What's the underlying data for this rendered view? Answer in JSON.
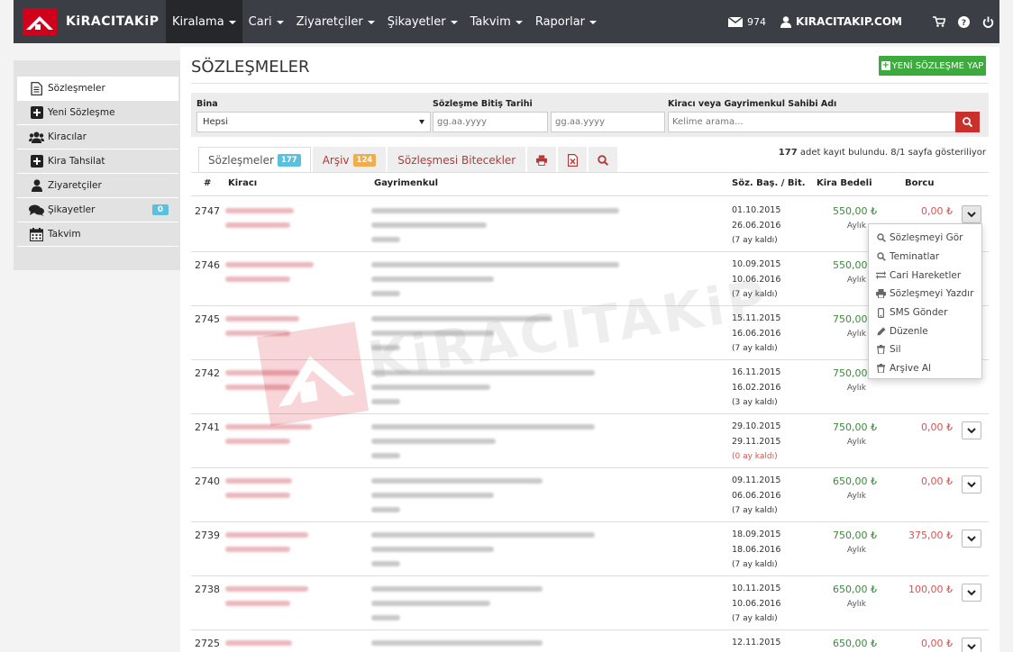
{
  "app": {
    "brand": "KiRACITAKiP",
    "nav": [
      "Kiralama",
      "Cari",
      "Ziyaretçiler",
      "Şikayetler",
      "Takvim",
      "Raporlar"
    ],
    "mail_count": "974",
    "site": "KIRACITAKIP.COM"
  },
  "sidebar": {
    "items": [
      {
        "label": "Sözleşmeler",
        "icon": "document-icon"
      },
      {
        "label": "Yeni Sözleşme",
        "icon": "plus-box-icon"
      },
      {
        "label": "Kiracılar",
        "icon": "users-icon"
      },
      {
        "label": "Kira Tahsilat",
        "icon": "plus-box-icon"
      },
      {
        "label": "Ziyaretçiler",
        "icon": "user-icon"
      },
      {
        "label": "Şikayetler",
        "icon": "comments-icon",
        "badge": "0"
      },
      {
        "label": "Takvim",
        "icon": "calendar-icon"
      }
    ]
  },
  "page": {
    "title": "SÖZLEŞMELER",
    "new_button": "YENİ SÖZLEŞME YAP"
  },
  "filters": {
    "bina_label": "Bina",
    "bina_value": "Hepsi",
    "date_label": "Sözleşme Bitiş Tarihi",
    "date_from_placeholder": "gg.aa.yyyy",
    "date_to_placeholder": "gg.aa.yyyy",
    "search_label": "Kiracı veya Gayrimenkul Sahibi Adı",
    "search_placeholder": "Kelime arama..."
  },
  "tabs": {
    "contracts": "Sözleşmeler",
    "contracts_count": "177",
    "archive": "Arşiv",
    "archive_count": "124",
    "ending": "Sözleşmesi Bitecekler"
  },
  "record_info": {
    "count": "177",
    "text": "adet kayıt bulundu. 8/1 sayfa gösteriliyor"
  },
  "table": {
    "headers": {
      "no": "#",
      "tenant": "Kiracı",
      "property": "Gayrimenkul",
      "dates": "Söz. Baş. / Bit.",
      "rent": "Kira Bedeli",
      "debt": "Borcu"
    },
    "rows": [
      {
        "no": "2747",
        "start": "01.10.2015",
        "end": "26.06.2016",
        "remaining": "(7 ay kaldı)",
        "rent": "550,00 ₺",
        "period": "Aylık",
        "debt": "0,00 ₺"
      },
      {
        "no": "2746",
        "start": "10.09.2015",
        "end": "10.06.2016",
        "remaining": "(7 ay kaldı)",
        "rent": "550,00 ₺",
        "period": "Aylık",
        "debt": ""
      },
      {
        "no": "2745",
        "start": "15.11.2015",
        "end": "16.06.2016",
        "remaining": "(7 ay kaldı)",
        "rent": "750,00 ₺",
        "period": "Aylık",
        "debt": ""
      },
      {
        "no": "2742",
        "start": "16.11.2015",
        "end": "16.02.2016",
        "remaining": "(3 ay kaldı)",
        "rent": "750,00 ₺",
        "period": "Aylık",
        "debt": ""
      },
      {
        "no": "2741",
        "start": "29.10.2015",
        "end": "29.11.2015",
        "remaining": "(0 ay kaldı)",
        "rent": "750,00 ₺",
        "period": "Aylık",
        "debt": "0,00 ₺"
      },
      {
        "no": "2740",
        "start": "09.11.2015",
        "end": "06.06.2016",
        "remaining": "(7 ay kaldı)",
        "rent": "650,00 ₺",
        "period": "Aylık",
        "debt": "0,00 ₺"
      },
      {
        "no": "2739",
        "start": "18.09.2015",
        "end": "18.06.2016",
        "remaining": "(7 ay kaldı)",
        "rent": "750,00 ₺",
        "period": "Aylık",
        "debt": "375,00 ₺"
      },
      {
        "no": "2738",
        "start": "10.11.2015",
        "end": "10.06.2016",
        "remaining": "(7 ay kaldı)",
        "rent": "650,00 ₺",
        "period": "Aylık",
        "debt": "100,00 ₺"
      },
      {
        "no": "2725",
        "start": "12.11.2015",
        "end": "",
        "remaining": "",
        "rent": "650,00 ₺",
        "period": "",
        "debt": "0,00 ₺"
      }
    ]
  },
  "dropdown": {
    "items": [
      {
        "label": "Sözleşmeyi Gör",
        "icon": "zoom-icon"
      },
      {
        "label": "Teminatlar",
        "icon": "zoom-icon"
      },
      {
        "label": "Cari Hareketler",
        "icon": "exchange-icon"
      },
      {
        "label": "Sözleşmeyi Yazdır",
        "icon": "print-icon"
      },
      {
        "label": "SMS Gönder",
        "icon": "mobile-icon"
      },
      {
        "label": "Düzenle",
        "icon": "pencil-icon"
      },
      {
        "label": "Sil",
        "icon": "trash-icon"
      },
      {
        "label": "Arşive Al",
        "icon": "trash-icon"
      }
    ]
  },
  "watermark": "KiRACITAKiP",
  "colors": {
    "navbar": "#3b3e45",
    "brand_red": "#d0021b",
    "green_button": "#3caa3c",
    "rent_green": "#3a8a3a",
    "debt_red": "#d9534f",
    "info_blue": "#5bc0de",
    "warning_orange": "#f0ad4e"
  }
}
